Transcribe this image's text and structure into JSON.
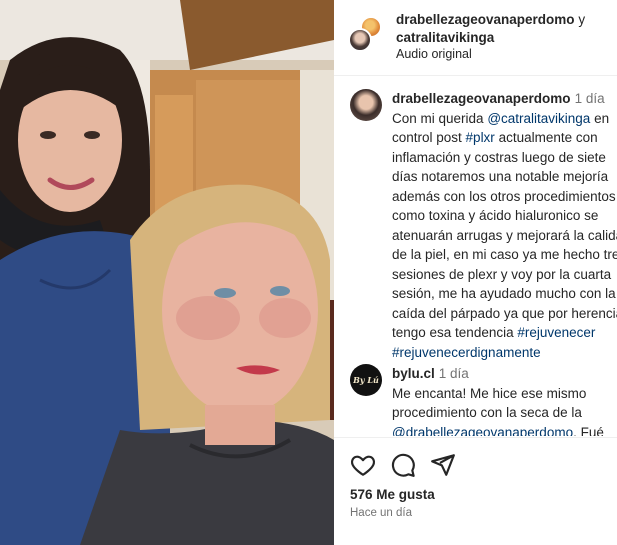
{
  "header": {
    "user1": "drabellezageovanaperdomo",
    "conjunction": "y",
    "user2": "catralitavikinga",
    "audio": "Audio original",
    "avatar_icon": "user-avatar-icon"
  },
  "comments": [
    {
      "username": "drabellezageovanaperdomo",
      "time": "1 día",
      "lines": [
        [
          {
            "t": "Con mi querida "
          },
          {
            "t": "@catralitavikinga",
            "k": "mention"
          },
          {
            "t": " en"
          }
        ],
        [
          {
            "t": "control post "
          },
          {
            "t": "#plxr",
            "k": "tag"
          },
          {
            "t": " actualmente con"
          }
        ],
        [
          {
            "t": "inflamación y costras luego de siete"
          }
        ],
        [
          {
            "t": "días notaremos una notable mejoría"
          }
        ],
        [
          {
            "t": "además con los otros procedimientos"
          }
        ],
        [
          {
            "t": "como toxina y ácido hialuronico se"
          }
        ],
        [
          {
            "t": "atenuarán arrugas y mejorará la calidad"
          }
        ],
        [
          {
            "t": "de la piel, en mi caso ya me hecho tres"
          }
        ],
        [
          {
            "t": "sesiones de plexr y voy por la cuarta"
          }
        ],
        [
          {
            "t": "sesión, me ha ayudado mucho con la"
          }
        ],
        [
          {
            "t": "caída del párpado ya que por herencia"
          }
        ],
        [
          {
            "t": "tengo esa tendencia "
          },
          {
            "t": "#rejuvenecer",
            "k": "tag"
          }
        ],
        [
          {
            "t": "#rejuvenecerdignamente",
            "k": "tag"
          }
        ]
      ]
    },
    {
      "username": "bylu.cl",
      "time": "1 día",
      "avatar_text": "By Lú",
      "lines": [
        [
          {
            "t": "Me encanta! Me hice ese mismo"
          }
        ],
        [
          {
            "t": "procedimiento con la seca de la"
          }
        ],
        [
          {
            "t": "@drabellezageovanaperdomo",
            "k": "mention"
          },
          {
            "t": ". Fué"
          }
        ]
      ]
    }
  ],
  "actions": {
    "like_icon": "heart-icon",
    "comment_icon": "comment-bubble-icon",
    "share_icon": "paper-plane-icon",
    "likes": "576 Me gusta",
    "posted": "Hace un día"
  },
  "colors": {
    "link": "#00376b",
    "secondary_text": "#737373",
    "divider": "#efefef"
  }
}
